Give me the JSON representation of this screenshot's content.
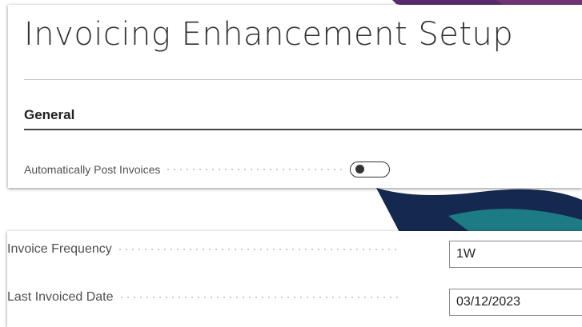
{
  "page": {
    "title": "Invoicing Enhancement Setup"
  },
  "general": {
    "header": "General",
    "auto_post": {
      "label": "Automatically Post Invoices",
      "enabled": false
    }
  },
  "fields": {
    "invoice_frequency": {
      "label": "Invoice Frequency",
      "value": "1W"
    },
    "last_invoiced_date": {
      "label": "Last Invoiced Date",
      "value": "03/12/2023"
    }
  },
  "colors": {
    "background_purple": "#5a2a6e",
    "background_navy": "#142850",
    "background_teal": "#1f8a8e",
    "toggle_off": "#333333"
  }
}
